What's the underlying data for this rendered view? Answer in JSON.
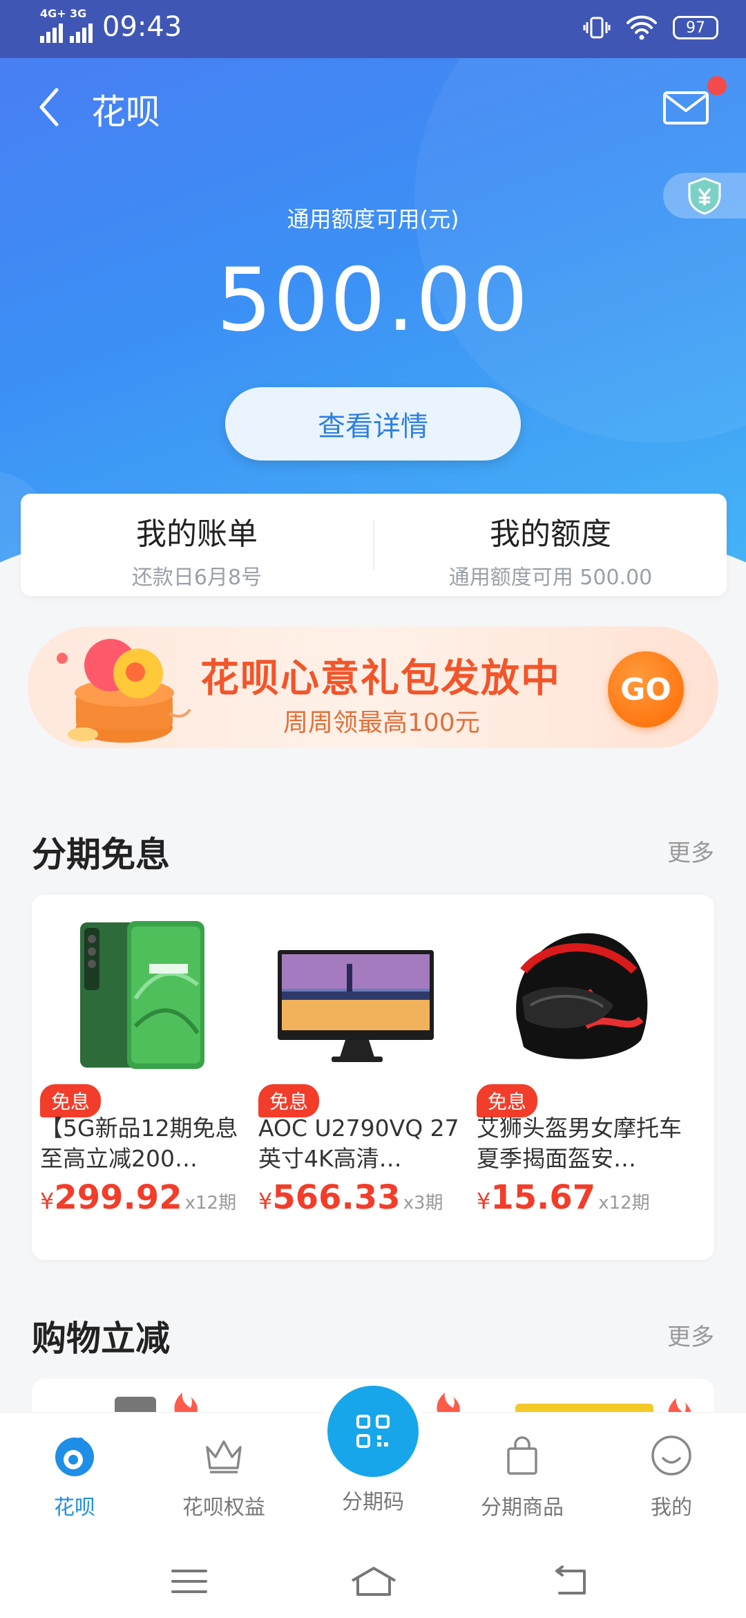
{
  "status_bar": {
    "network_1": "4G+",
    "network_2": "3G",
    "time": "09:43",
    "battery": "97"
  },
  "header": {
    "title": "花呗",
    "credit_label": "通用额度可用(元)",
    "amount": "500.00",
    "detail_button": "查看详情"
  },
  "summary": {
    "bill_title": "我的账单",
    "bill_sub": "还款日6月8号",
    "quota_title": "我的额度",
    "quota_sub": "通用额度可用 500.00"
  },
  "banner": {
    "title": "花呗心意礼包发放中",
    "subtitle": "周周领最高100元",
    "go": "GO"
  },
  "section_installment": {
    "title": "分期免息",
    "more": "更多",
    "products": [
      {
        "tag": "免息",
        "name": "【5G新品12期免息 至高立减200…",
        "currency": "¥",
        "price": "299.92",
        "period": "x12期"
      },
      {
        "tag": "免息",
        "name": "AOC U2790VQ 27英寸4K高清…",
        "currency": "¥",
        "price": "566.33",
        "period": "x3期"
      },
      {
        "tag": "免息",
        "name": "艾狮头盔男女摩托车夏季揭面盔安…",
        "currency": "¥",
        "price": "15.67",
        "period": "x12期"
      }
    ]
  },
  "section_discount": {
    "title": "购物立减",
    "more": "更多"
  },
  "tabbar": {
    "items": [
      {
        "label": "花呗"
      },
      {
        "label": "花呗权益"
      },
      {
        "label": "分期码"
      },
      {
        "label": "分期商品"
      },
      {
        "label": "我的"
      }
    ]
  },
  "colors": {
    "primary": "#3c8ff5",
    "accent_red": "#f23d2a",
    "tab_active": "#1e8ee6"
  }
}
